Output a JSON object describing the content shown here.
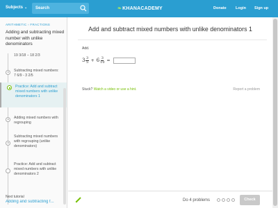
{
  "header": {
    "subjects_label": "Subjects",
    "search_placeholder": "Search",
    "logo_text": "KHANACADEMY",
    "nav": [
      "Donate",
      "Login",
      "Sign up"
    ]
  },
  "sidebar": {
    "breadcrumb": "ARITHMETIC › FRACTIONS",
    "title": "Adding and subtracting mixed number with unlike denominators",
    "items": [
      {
        "label": "19 3/18 − 18 2/3",
        "kind": "video"
      },
      {
        "label": "Subtracting mixed numbers: 7 6/9 - 3 2/5",
        "kind": "video"
      },
      {
        "label": "Practice: Add and subtract mixed numbers with unlike denominators 1",
        "kind": "practice",
        "active": true
      },
      {
        "label": "Adding mixed numbers with regrouping",
        "kind": "video"
      },
      {
        "label": "Subtracting mixed numbers with regrouping (unlike denominators)",
        "kind": "video"
      },
      {
        "label": "Practice: Add and subtract mixed numbers with unlike denominators 2",
        "kind": "practice"
      }
    ],
    "next_label": "Next tutorial",
    "next_link": "Adding and subtracting f..."
  },
  "exercise": {
    "title": "Add and subtract mixed numbers with unlike denominators 1",
    "prompt": "Add.",
    "term1": {
      "whole": "3",
      "num": "3",
      "den": "5"
    },
    "operator": "+",
    "term2": {
      "whole": "6",
      "num": "3",
      "den": "10"
    },
    "equals": "=",
    "answer_value": "",
    "stuck_text": "Stuck?",
    "hint_text": "Watch a video or use a hint.",
    "report_text": "Report a problem"
  },
  "footer": {
    "problem_count": "Do 4 problems",
    "progress_total": 4,
    "check_label": "Check"
  },
  "colors": {
    "header_blue": "#2a9ed1",
    "link_green": "#78c008",
    "check_disabled": "#c9c9c9"
  }
}
